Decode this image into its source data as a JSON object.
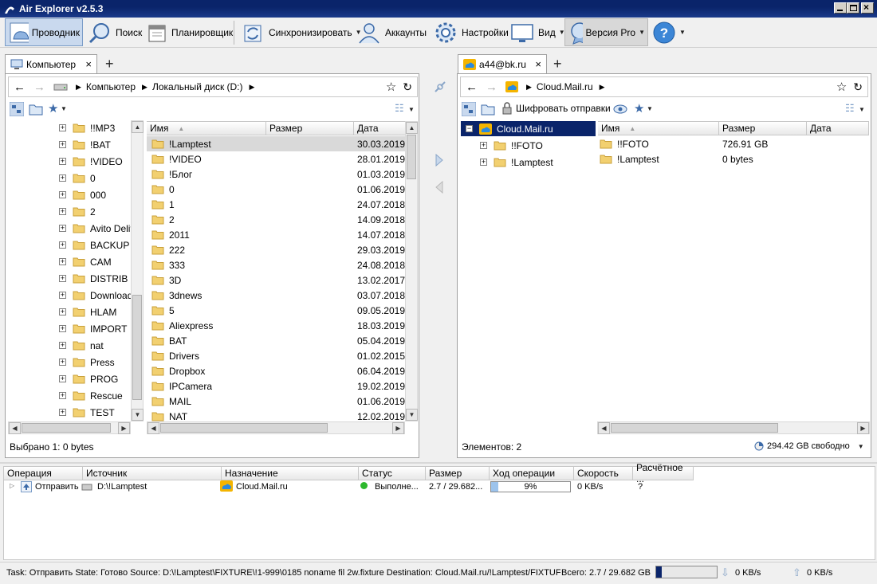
{
  "window": {
    "title": "Air Explorer v2.5.3"
  },
  "toolbar": {
    "explorer": "Проводник",
    "search": "Поиск",
    "scheduler": "Планировщик",
    "sync": "Синхронизировать",
    "accounts": "Аккаунты",
    "settings": "Настройки",
    "view": "Вид",
    "pro": "Версия Pro"
  },
  "left": {
    "tab_label": "Компьютер",
    "breadcrumb": [
      "Компьютер",
      "Локальный диск (D:)"
    ],
    "tree": [
      "!!MP3",
      "!BAT",
      "!VIDEO",
      "0",
      "000",
      "2",
      "Avito Deliv",
      "BACKUP",
      "CAM",
      "DISTRIB",
      "Download",
      "HLAM",
      "IMPORT",
      "nat",
      "Press",
      "PROG",
      "Rescue",
      "TEST"
    ],
    "columns": {
      "name": "Имя",
      "size": "Размер",
      "date": "Дата"
    },
    "files": [
      {
        "name": "!Lamptest",
        "date": "30.03.2019"
      },
      {
        "name": "!VIDEO",
        "date": "28.01.2019"
      },
      {
        "name": "!Блог",
        "date": "01.03.2019"
      },
      {
        "name": "0",
        "date": "01.06.2019"
      },
      {
        "name": "1",
        "date": "24.07.2018"
      },
      {
        "name": "2",
        "date": "14.09.2018"
      },
      {
        "name": "2011",
        "date": "14.07.2018"
      },
      {
        "name": "222",
        "date": "29.03.2019"
      },
      {
        "name": "333",
        "date": "24.08.2018"
      },
      {
        "name": "3D",
        "date": "13.02.2017"
      },
      {
        "name": "3dnews",
        "date": "03.07.2018"
      },
      {
        "name": "5",
        "date": "09.05.2019"
      },
      {
        "name": "Aliexpress",
        "date": "18.03.2019"
      },
      {
        "name": "BAT",
        "date": "05.04.2019"
      },
      {
        "name": "Drivers",
        "date": "01.02.2015"
      },
      {
        "name": "Dropbox",
        "date": "06.04.2019"
      },
      {
        "name": "IPCamera",
        "date": "19.02.2019"
      },
      {
        "name": "MAIL",
        "date": "01.06.2019"
      },
      {
        "name": "NAT",
        "date": "12.02.2019"
      }
    ],
    "status": "Выбрано 1: 0 bytes"
  },
  "right": {
    "tab_label": "a44@bk.ru",
    "breadcrumb": [
      "Cloud.Mail.ru"
    ],
    "encrypt_label": "Шифровать отправки",
    "tree_root": "Cloud.Mail.ru",
    "tree": [
      "!!FOTO",
      "!Lamptest"
    ],
    "columns": {
      "name": "Имя",
      "size": "Размер",
      "date": "Дата"
    },
    "files": [
      {
        "name": "!!FOTO",
        "size": "726.91 GB"
      },
      {
        "name": "!Lamptest",
        "size": "0 bytes"
      }
    ],
    "status": "Элементов: 2",
    "free": "294.42 GB свободно"
  },
  "transfers": {
    "columns": {
      "op": "Операция",
      "src": "Источник",
      "dst": "Назначение",
      "status": "Статус",
      "size": "Размер",
      "progress": "Ход операции",
      "speed": "Скорость",
      "eta": "Расчётное ..."
    },
    "row": {
      "op": "Отправить",
      "src": "D:\\!Lamptest",
      "dst": "Cloud.Mail.ru",
      "status": "Выполне...",
      "size": "2.7 / 29.682...",
      "progress": "9%",
      "progress_value": 0.09,
      "speed": "0 KB/s",
      "eta": "?"
    }
  },
  "statusbar": {
    "task": "Task: Отправить State: Готово Source: D:\\!Lamptest\\FIXTURE\\!1-999\\0185 noname fil 2w.fixture Destination: Cloud.Mail.ru/!Lamptest/FIXTUF",
    "total": "Всего: 2.7 / 29.682 GB",
    "total_value": 0.09,
    "down": "0 KB/s",
    "up": "0 KB/s"
  },
  "colors": {
    "selection": "#0a246a",
    "folder": "#e8c04a",
    "cloud": "#2a8ae0"
  }
}
